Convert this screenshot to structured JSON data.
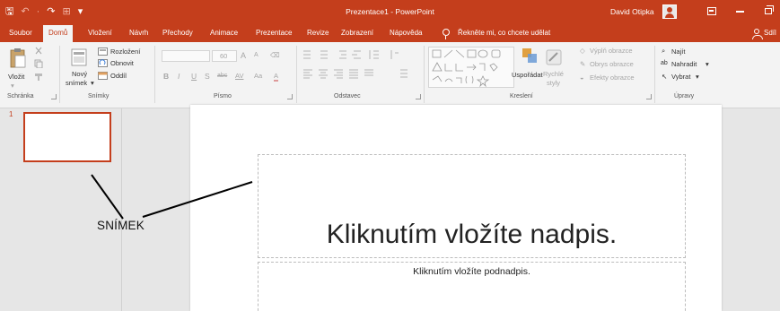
{
  "window": {
    "quick_access": {
      "save": "🖫",
      "undo": "↶",
      "undo_menu": "·",
      "redo": "↷",
      "present": "⊞",
      "customize": "▾"
    },
    "title": "Prezentace1 - PowerPoint",
    "user": "David Otipka",
    "colors": {
      "accent": "#c43e1c",
      "ribbon_bg": "#f3f3f3",
      "workspace": "#e6e6e6"
    }
  },
  "tabs": [
    {
      "label": "Soubor",
      "active": false
    },
    {
      "label": "Domů",
      "active": true
    },
    {
      "label": "Vložení",
      "active": false
    },
    {
      "label": "Návrh",
      "active": false
    },
    {
      "label": "Přechody",
      "active": false
    },
    {
      "label": "Animace",
      "active": false
    },
    {
      "label": "Prezentace",
      "active": false
    },
    {
      "label": "Revize",
      "active": false
    },
    {
      "label": "Zobrazení",
      "active": false
    },
    {
      "label": "Nápověda",
      "active": false
    }
  ],
  "tellme": "Řekněte mi, co chcete udělat",
  "share": "Sdíl",
  "ribbon": {
    "clipboard": {
      "paste": "Vložit",
      "label": "Schránka"
    },
    "slides": {
      "new_slide_1": "Nový",
      "new_slide_2": "snímek",
      "layout": "Rozložení",
      "reset": "Obnovit",
      "section": "Oddíl",
      "label": "Snímky"
    },
    "font": {
      "size": "60",
      "grow": "A",
      "shrink": "A",
      "bold": "B",
      "italic": "I",
      "underline": "U",
      "shadow": "S",
      "strike": "abc",
      "spacing": "AV",
      "case": "Aa",
      "color": "A",
      "label": "Písmo"
    },
    "paragraph": {
      "label": "Odstavec"
    },
    "drawing": {
      "arrange": "Uspořádat",
      "quick_styles_1": "Rychlé",
      "quick_styles_2": "styly",
      "fill": "Výplň obrazce",
      "outline": "Obrys obrazce",
      "effects": "Efekty obrazce",
      "label": "Kreslení"
    },
    "editing": {
      "find": "Najít",
      "replace": "Nahradit",
      "select": "Vybrat",
      "label": "Úpravy"
    }
  },
  "thumbnails": {
    "slide_number": "1"
  },
  "slide": {
    "title_placeholder": "Kliknutím vložíte nadpis.",
    "subtitle_placeholder": "Kliknutím vložíte podnadpis."
  },
  "annotation": {
    "label": "SNÍMEK"
  }
}
